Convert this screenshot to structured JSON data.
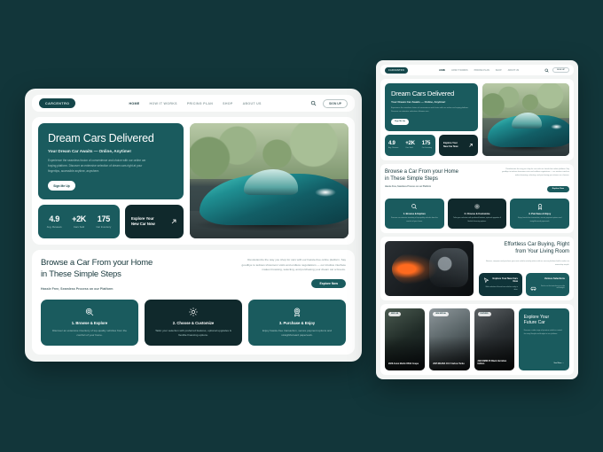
{
  "theme": {
    "page_bg": "#12363a",
    "card_teal": "#1a5b5e",
    "card_dark": "#10292c",
    "surface": "#f2f4f3",
    "white": "#ffffff"
  },
  "desktop": {
    "nav": {
      "logo": "CARCENTRO",
      "links": [
        {
          "label": "HOME",
          "active": true
        },
        {
          "label": "HOW IT WORKS",
          "active": false
        },
        {
          "label": "PRICING PLAN",
          "active": false
        },
        {
          "label": "SHOP",
          "active": false
        },
        {
          "label": "ABOUT US",
          "active": false
        }
      ],
      "search_icon": "search-icon",
      "signup_label": "SIGN UP"
    },
    "hero": {
      "title": "Dream Cars Delivered",
      "subtitle": "Your Dream Car Awaits — Online, Anytime!",
      "body": "Experience the seamless fusion of convenience and choice with our online car buying platform. Discover an extensive selection of dream cars right at your fingertips, accessible anytime, anywhere.",
      "button": "Sign Me Up",
      "image_alt": "teal-sports-car-photo"
    },
    "stats": [
      {
        "value": "4.9",
        "label": "Avg. Reviews"
      },
      {
        "value": "+2K",
        "label": "Cars Sold"
      },
      {
        "value": "175",
        "label": "Car Inventory"
      }
    ],
    "explore_card": {
      "line1": "Explore Your",
      "line2": "New Car Now",
      "icon": "arrow-up-right-icon"
    },
    "steps": {
      "heading_line1": "Browse a Car From your Home",
      "heading_line2": "in These Simple Steps",
      "subheading": "Hassle Free, Seamless Process on our Platform",
      "paragraph": "Revolutionize the way you shop for cars with our hassle-free online platform. Say goodbye to tedious showroom visits and endless negotiations — our intuitive interface makes browsing, selecting, and purchasing your dream car a breeze.",
      "button": "Explore Now",
      "cards": [
        {
          "title": "1. Browse & Explore",
          "desc": "Discover an extensive inventory of top-quality vehicles from the comfort of your home.",
          "icon": "magnifier-icon",
          "dark": false
        },
        {
          "title": "2. Choose & Customize",
          "desc": "Tailor your selection with preferred features, optional upgrades & flexible financing options.",
          "icon": "gear-icon",
          "dark": true
        },
        {
          "title": "3. Purchase & Enjoy",
          "desc": "Enjoy hassle-free transaction, secure payment options and straightforward paperwork.",
          "icon": "badge-icon",
          "dark": false
        }
      ]
    }
  },
  "tablet": {
    "nav": {
      "logo": "CARCENTRO",
      "links": [
        {
          "label": "HOME",
          "active": true
        },
        {
          "label": "HOW IT WORKS",
          "active": false
        },
        {
          "label": "PRICING PLAN",
          "active": false
        },
        {
          "label": "SHOP",
          "active": false
        },
        {
          "label": "ABOUT US",
          "active": false
        }
      ],
      "search_icon": "search-icon",
      "signup_label": "SIGN UP"
    },
    "hero": {
      "title": "Dream Cars Delivered",
      "subtitle": "Your Dream Car Awaits — Online, Anytime!",
      "body": "Experience the seamless fusion of convenience and choice with our online car buying platform. Discover an extensive selection of dream cars.",
      "button": "Sign Me Up"
    },
    "stats": [
      {
        "value": "4.9",
        "label": "Avg. Reviews"
      },
      {
        "value": "+2K",
        "label": "Cars Sold"
      },
      {
        "value": "175",
        "label": "Car Inventory"
      }
    ],
    "explore_card": {
      "line1": "Explore Your",
      "line2": "New Car Now",
      "icon": "arrow-up-right-icon"
    },
    "steps": {
      "heading_line1": "Browse a Car From your Home",
      "heading_line2": "in These Simple Steps",
      "subheading": "Hassle Free, Seamless Process on our Platform",
      "paragraph": "Revolutionize the way you shop for cars with our hassle-free online platform. Say goodbye to tedious showroom visits and endless negotiations — our intuitive interface makes browsing, selecting, and purchasing your dream car a breeze.",
      "button": "Explore Now",
      "cards": [
        {
          "title": "1. Browse & Explore",
          "desc": "Discover an extensive inventory of top-quality vehicles from the comfort of your home.",
          "icon": "magnifier-icon",
          "dark": false
        },
        {
          "title": "2. Choose & Customize",
          "desc": "Tailor your selection with preferred features, optional upgrades & flexible financing options.",
          "icon": "gear-icon",
          "dark": true
        },
        {
          "title": "3. Purchase & Enjoy",
          "desc": "Enjoy hassle-free transaction, secure payment options and straightforward paperwork.",
          "icon": "badge-icon",
          "dark": false
        }
      ]
    },
    "effortless": {
      "heading_line1": "Effortless Car Buying, Right",
      "heading_line2": "from Your Living Room",
      "paragraph": "Browse, compare and purchase your next vehicle entirely online with our secure platform built to make car ownership simple.",
      "image_alt": "car-interior-steering-wheel-photo",
      "cards": [
        {
          "title": "Explore Your New Cars Now",
          "desc": "Wide selection of brand new vehicles ready to drive.",
          "icon": "cursor-icon"
        },
        {
          "title": "Various Selections",
          "desc": "Find a car that matches your style and budget.",
          "icon": "car-icon"
        }
      ]
    },
    "listings": {
      "cars": [
        {
          "tag": "NEW CAR",
          "name": "2026 Aston Martin DB12 Coupe"
        },
        {
          "tag": "NEW ARRIVAL",
          "name": "2025 MAZDA CX-5 Carbon Turbo"
        },
        {
          "tag": "FEATURED",
          "name": "2026 BMW X5 Black Vermilion Edition"
        }
      ],
      "promo": {
        "heading_line1": "Explore Your",
        "heading_line2": "Future Car",
        "paragraph": "Discover a wide range of premium vehicles curated for every lifestyle and budget on our platform.",
        "button": "See More →"
      }
    }
  }
}
